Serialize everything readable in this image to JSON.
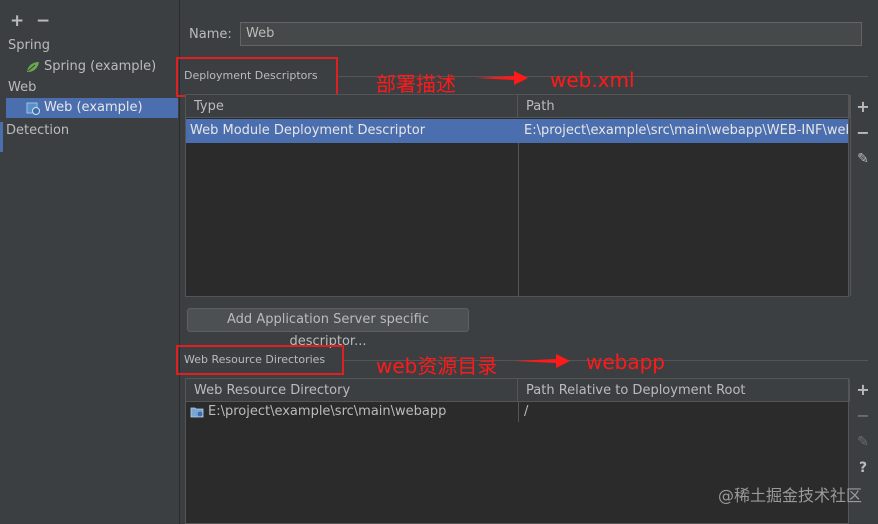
{
  "left": {
    "add": "+",
    "remove": "−",
    "tree": [
      {
        "label": "Spring",
        "kind": "group"
      },
      {
        "label": "Spring (example)",
        "kind": "child"
      },
      {
        "label": "Web",
        "kind": "group"
      },
      {
        "label": "Web (example)",
        "kind": "child",
        "selected": true
      },
      {
        "label": "Detection",
        "kind": "group"
      }
    ]
  },
  "name": {
    "label": "Name:",
    "value": "Web"
  },
  "descriptors": {
    "label": "Deployment Descriptors",
    "columns": [
      "Type",
      "Path"
    ],
    "rows": [
      {
        "type": "Web Module Deployment Descriptor",
        "path": "E:\\project\\example\\src\\main\\webapp\\WEB-INF\\web.xml",
        "selected": true
      }
    ],
    "tools": [
      "+",
      "−",
      "✎"
    ]
  },
  "add_descriptor_button": "Add Application Server specific descriptor...",
  "resources": {
    "label": "Web Resource Directories",
    "columns": [
      "Web Resource Directory",
      "Path Relative to Deployment Root"
    ],
    "rows": [
      {
        "dir": "E:\\project\\example\\src\\main\\webapp",
        "rel": "/"
      }
    ],
    "tools": [
      "+",
      "−",
      "✎",
      "?"
    ]
  },
  "annotations": {
    "a1": "部署描述",
    "a1_target": "web.xml",
    "a2": "web资源目录",
    "a2_target": "webapp"
  },
  "watermark": "@稀土掘金技术社区",
  "colors": {
    "selection": "#4b6eaf",
    "annotation": "#ff1a1a",
    "leaf": "#6aa84f"
  }
}
